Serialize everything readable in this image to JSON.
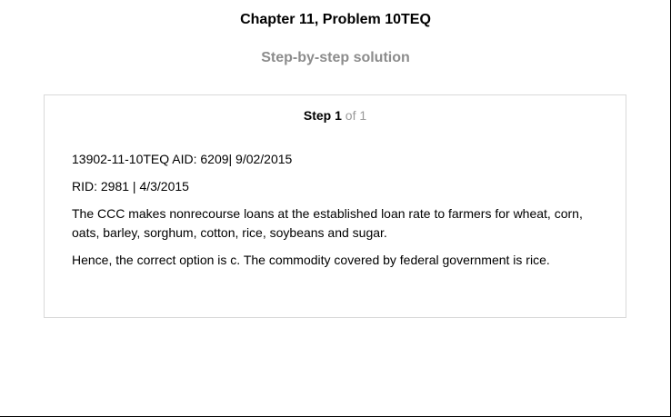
{
  "header": {
    "title": "Chapter 11, Problem 10TEQ",
    "subtitle": "Step-by-step solution"
  },
  "step": {
    "label": "Step",
    "number": "1",
    "of_text": "of 1",
    "paragraphs": [
      "13902-11-10TEQ AID: 6209| 9/02/2015",
      "RID: 2981 | 4/3/2015",
      "The CCC makes nonrecourse loans at the established loan rate to farmers for wheat, corn, oats, barley, sorghum, cotton, rice, soybeans and sugar.",
      "Hence, the correct option is c. The commodity covered by federal government is rice."
    ]
  },
  "colors": {
    "subtitle": "#8c8c8c",
    "card_border": "#d9d9d9",
    "step_of": "#9a9a9a"
  }
}
